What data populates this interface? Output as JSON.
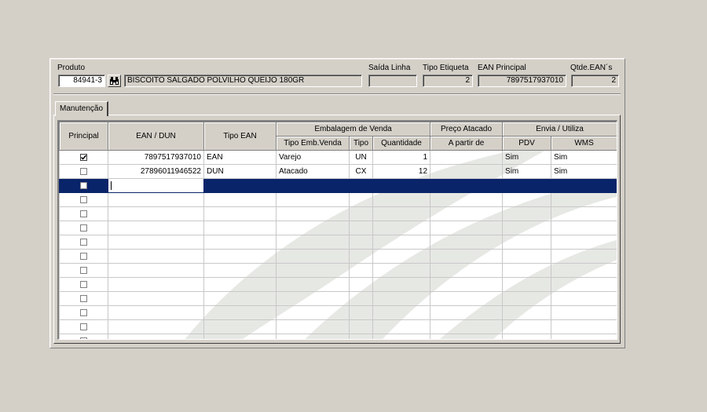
{
  "product": {
    "label": "Produto",
    "code": "84941-3",
    "description": "BISCOITO SALGADO POLVILHO QUEIJO 180GR",
    "saida_linha_label": "Saída Linha",
    "saida_linha_value": "",
    "tipo_etiqueta_label": "Tipo Etiqueta",
    "tipo_etiqueta_value": "2",
    "ean_principal_label": "EAN Principal",
    "ean_principal_value": "7897517937010",
    "qtde_eans_label": "Qtde.EAN´s",
    "qtde_eans_value": "2"
  },
  "tabs": [
    {
      "label": "Manutenção"
    }
  ],
  "grid": {
    "headers": {
      "principal": "Principal",
      "ean_dun": "EAN / DUN",
      "tipo_ean": "Tipo EAN",
      "embalagem_group": "Embalagem de Venda",
      "tipo_emb_venda": "Tipo Emb.Venda",
      "tipo": "Tipo",
      "quantidade": "Quantidade",
      "preco_group": "Preço Atacado",
      "a_partir_de": "A partir de",
      "envia_group": "Envia / Utiliza",
      "pdv": "PDV",
      "wms": "WMS"
    },
    "rows": [
      {
        "principal": true,
        "ean": "7897517937010",
        "tipo_ean": "EAN",
        "tipo_emb": "Varejo",
        "tipo": "UN",
        "quantidade": "1",
        "a_partir_de": "",
        "pdv": "Sim",
        "wms": "Sim",
        "selected": false
      },
      {
        "principal": false,
        "ean": "27896011946522",
        "tipo_ean": "DUN",
        "tipo_emb": "Atacado",
        "tipo": "CX",
        "quantidade": "12",
        "a_partir_de": "",
        "pdv": "Sim",
        "wms": "Sim",
        "selected": false
      },
      {
        "principal": false,
        "ean": "",
        "tipo_ean": "",
        "tipo_emb": "",
        "tipo": "",
        "quantidade": "",
        "a_partir_de": "",
        "pdv": "",
        "wms": "",
        "selected": true
      },
      {
        "principal": false,
        "ean": "",
        "tipo_ean": "",
        "tipo_emb": "",
        "tipo": "",
        "quantidade": "",
        "a_partir_de": "",
        "pdv": "",
        "wms": "",
        "selected": false
      },
      {
        "principal": false,
        "ean": "",
        "tipo_ean": "",
        "tipo_emb": "",
        "tipo": "",
        "quantidade": "",
        "a_partir_de": "",
        "pdv": "",
        "wms": "",
        "selected": false
      },
      {
        "principal": false,
        "ean": "",
        "tipo_ean": "",
        "tipo_emb": "",
        "tipo": "",
        "quantidade": "",
        "a_partir_de": "",
        "pdv": "",
        "wms": "",
        "selected": false
      },
      {
        "principal": false,
        "ean": "",
        "tipo_ean": "",
        "tipo_emb": "",
        "tipo": "",
        "quantidade": "",
        "a_partir_de": "",
        "pdv": "",
        "wms": "",
        "selected": false
      },
      {
        "principal": false,
        "ean": "",
        "tipo_ean": "",
        "tipo_emb": "",
        "tipo": "",
        "quantidade": "",
        "a_partir_de": "",
        "pdv": "",
        "wms": "",
        "selected": false
      },
      {
        "principal": false,
        "ean": "",
        "tipo_ean": "",
        "tipo_emb": "",
        "tipo": "",
        "quantidade": "",
        "a_partir_de": "",
        "pdv": "",
        "wms": "",
        "selected": false
      },
      {
        "principal": false,
        "ean": "",
        "tipo_ean": "",
        "tipo_emb": "",
        "tipo": "",
        "quantidade": "",
        "a_partir_de": "",
        "pdv": "",
        "wms": "",
        "selected": false
      },
      {
        "principal": false,
        "ean": "",
        "tipo_ean": "",
        "tipo_emb": "",
        "tipo": "",
        "quantidade": "",
        "a_partir_de": "",
        "pdv": "",
        "wms": "",
        "selected": false
      },
      {
        "principal": false,
        "ean": "",
        "tipo_ean": "",
        "tipo_emb": "",
        "tipo": "",
        "quantidade": "",
        "a_partir_de": "",
        "pdv": "",
        "wms": "",
        "selected": false
      },
      {
        "principal": false,
        "ean": "",
        "tipo_ean": "",
        "tipo_emb": "",
        "tipo": "",
        "quantidade": "",
        "a_partir_de": "",
        "pdv": "",
        "wms": "",
        "selected": false
      },
      {
        "principal": false,
        "ean": "",
        "tipo_ean": "",
        "tipo_emb": "",
        "tipo": "",
        "quantidade": "",
        "a_partir_de": "",
        "pdv": "",
        "wms": "",
        "selected": false
      }
    ]
  },
  "colors": {
    "window_bg": "#d4d0c8",
    "selection": "#0a246a",
    "watermark": "#e6e8e4"
  },
  "icons": {
    "find": "binoculars-icon",
    "check": "checkbox-icon"
  }
}
